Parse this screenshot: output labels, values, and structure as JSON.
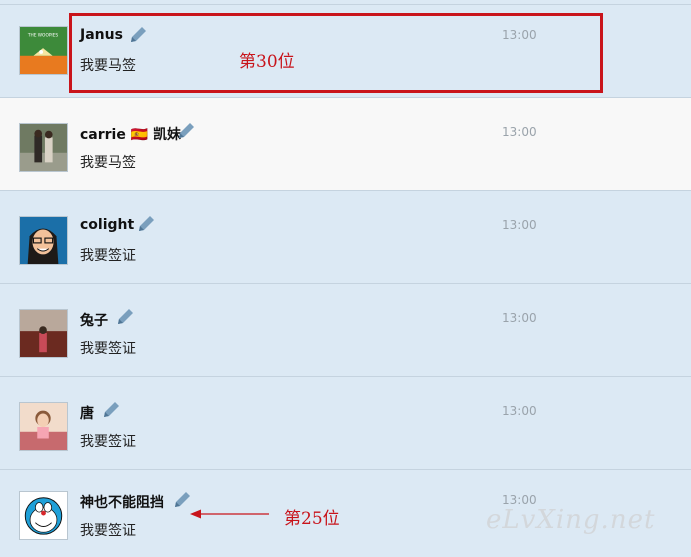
{
  "colors": {
    "row_blue": "#dce9f4",
    "row_white": "#f8f8f8",
    "annotation_red": "#c8141b",
    "pencil_icon": "#7a9fbd"
  },
  "rows": [
    {
      "name": "Janus",
      "message": "我要马签",
      "time": "13:00",
      "avatar": "green-bird-book-avatar",
      "avatar_text": "THE WOOPIES"
    },
    {
      "name": "carrie 🇪🇸 凯妹",
      "message": "我要马签",
      "time": "13:00",
      "avatar": "couple-photo-avatar"
    },
    {
      "name": "colight",
      "message": "我要签证",
      "time": "13:00",
      "avatar": "cartoon-face-avatar"
    },
    {
      "name": "兔子",
      "message": "我要签证",
      "time": "13:00",
      "avatar": "street-photo-avatar"
    },
    {
      "name": "唐",
      "message": "我要签证",
      "time": "13:00",
      "avatar": "girl-photo-avatar"
    },
    {
      "name": "神也不能阻挡",
      "message": "我要签证",
      "time": "13:00",
      "avatar": "doraemon-avatar"
    }
  ],
  "annotations": {
    "top_label": "第30位",
    "bottom_label": "第25位"
  },
  "watermark": "eLvXing.net"
}
